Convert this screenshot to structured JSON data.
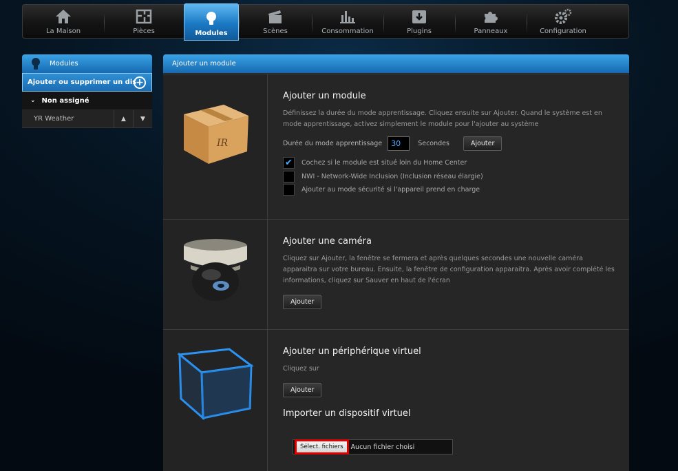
{
  "nav": [
    {
      "label": "La Maison",
      "icon": "house-icon",
      "active": false
    },
    {
      "label": "Pièces",
      "icon": "floorplan-icon",
      "active": false
    },
    {
      "label": "Modules",
      "icon": "bulb-icon",
      "active": true
    },
    {
      "label": "Scènes",
      "icon": "clapper-icon",
      "active": false
    },
    {
      "label": "Consommation",
      "icon": "chart-icon",
      "active": false
    },
    {
      "label": "Plugins",
      "icon": "download-box-icon",
      "active": false
    },
    {
      "label": "Panneaux",
      "icon": "puzzle-icon",
      "active": false
    },
    {
      "label": "Configuration",
      "icon": "gears-icon",
      "active": false
    }
  ],
  "sidebar": {
    "header": "Modules",
    "add_label": "Ajouter ou supprimer un dis",
    "group": "Non assigné",
    "rows": [
      "YR Weather"
    ]
  },
  "panel": {
    "header": "Ajouter un module",
    "module": {
      "title": "Ajouter un module",
      "desc": "Définissez la durée du mode apprentissage. Cliquez ensuite sur Ajouter. Quand le système est en mode apprentissage, activez simplement le module pour l'ajouter au système",
      "duration_label": "Durée du mode apprentissage",
      "duration_value": "30",
      "seconds_label": "Secondes",
      "add_button": "Ajouter",
      "checks": [
        {
          "label": "Cochez si le module est situé loin du Home Center",
          "checked": true
        },
        {
          "label": "NWI - Network-Wide Inclusion (Inclusion réseau élargie)",
          "checked": false
        },
        {
          "label": "Ajouter au mode sécurité si l'appareil prend en charge",
          "checked": false
        }
      ]
    },
    "camera": {
      "title": "Ajouter une caméra",
      "desc": "Cliquez sur Ajouter, la fenêtre se fermera et après quelques secondes une nouvelle caméra apparaitra sur votre bureau. Ensuite, la fenêtre de configuration apparaitra. Après avoir complété les informations, cliquez sur Sauver en haut de l'écran",
      "add_button": "Ajouter"
    },
    "virtual": {
      "title": "Ajouter un périphérique virtuel",
      "desc": "Cliquez sur",
      "add_button": "Ajouter",
      "import_title": "Importer un dispositif virtuel",
      "file_button": "Sélect. fichiers",
      "file_status": "Aucun fichier choisi"
    }
  },
  "colors": {
    "accent": "#1b79c4",
    "highlight": "#e00000",
    "value": "#4aa8ff"
  }
}
